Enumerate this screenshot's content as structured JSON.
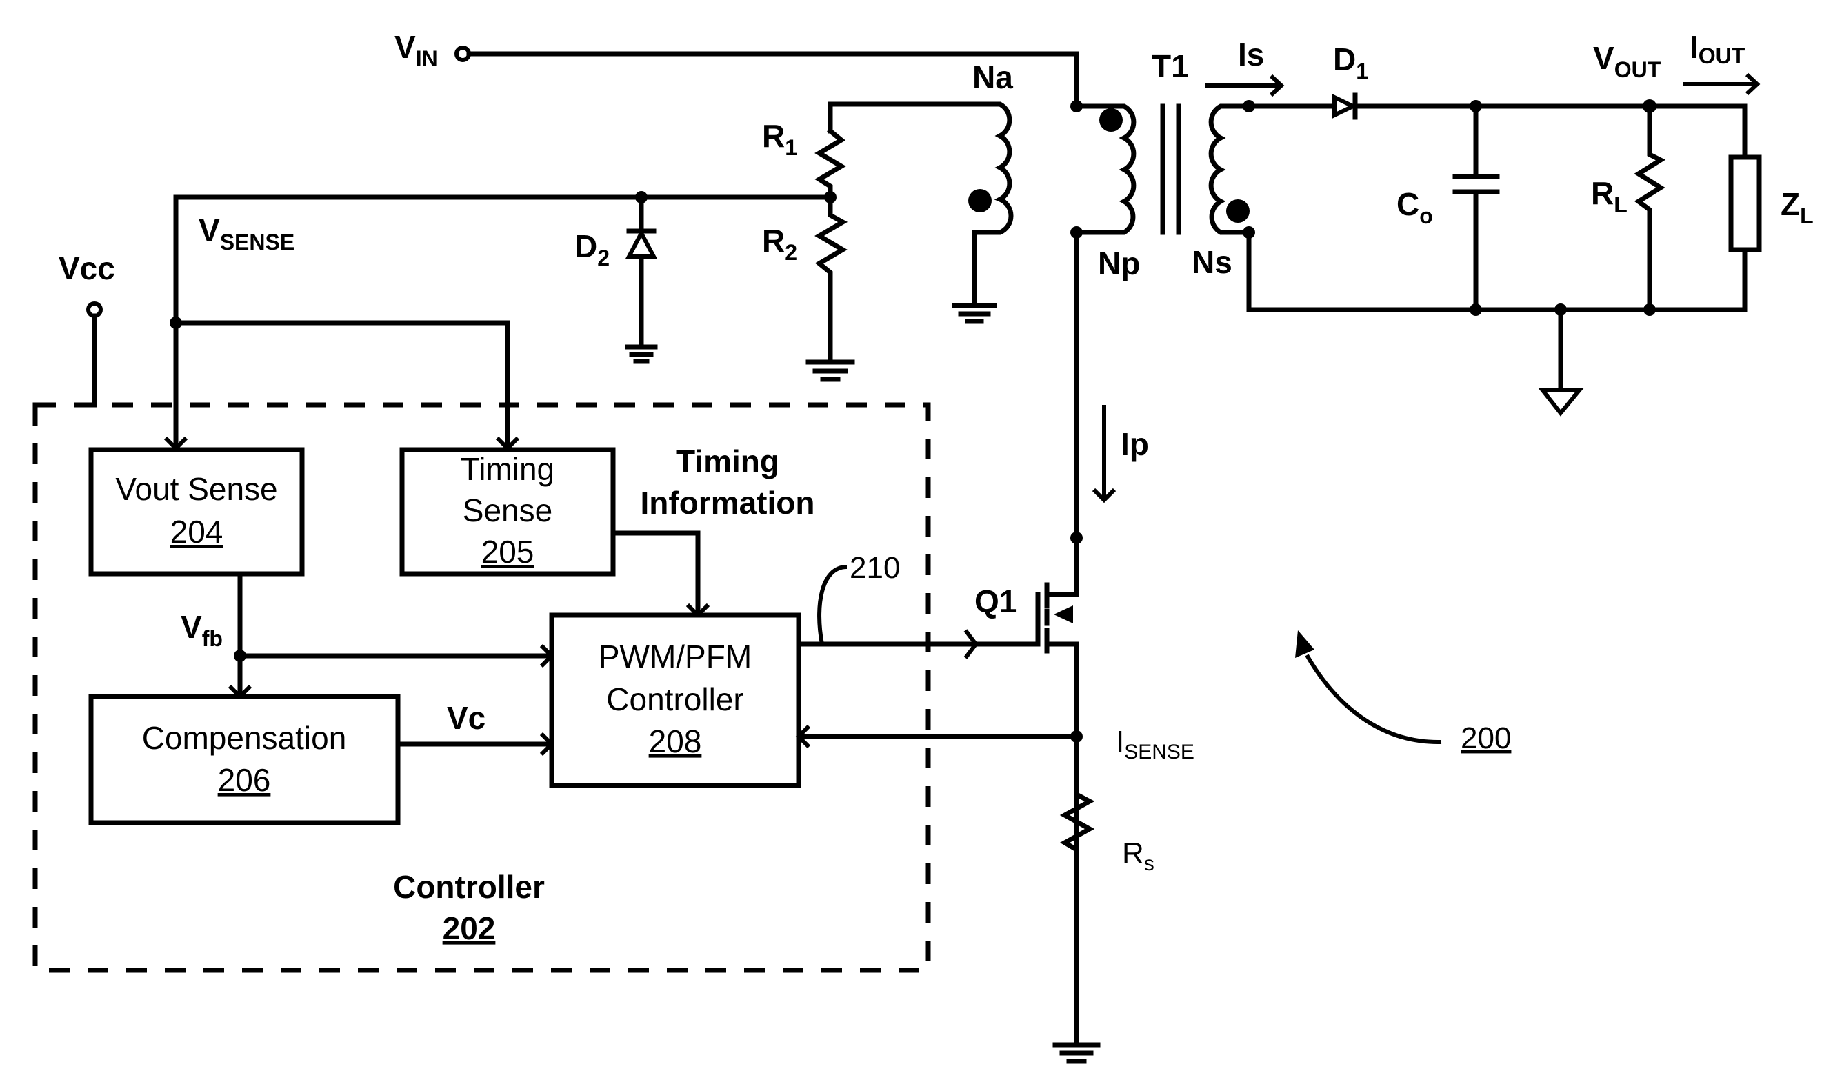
{
  "figure": {
    "reference_number": "200",
    "colors": {
      "ink": "#000000",
      "background": "#ffffff"
    }
  },
  "terminals": {
    "vin": {
      "main": "V",
      "sub": "IN"
    },
    "vcc": {
      "main": "Vcc"
    },
    "vout": {
      "main": "V",
      "sub": "OUT"
    },
    "iout": {
      "main": "I",
      "sub": "OUT"
    }
  },
  "signals": {
    "vsense": {
      "main": "V",
      "sub": "SENSE"
    },
    "vfb": {
      "main": "V",
      "sub": "fb"
    },
    "vc": "Vc",
    "isense": {
      "main": "I",
      "sub": "SENSE"
    },
    "is": "Is",
    "ip": "Ip",
    "timing_info_line1": "Timing",
    "timing_info_line2": "Information",
    "gate_drive_ref": "210"
  },
  "components": {
    "transformer": "T1",
    "winding_aux": "Na",
    "winding_primary": "Np",
    "winding_secondary": "Ns",
    "d1": {
      "main": "D",
      "sub": "1"
    },
    "d2": {
      "main": "D",
      "sub": "2"
    },
    "r1": {
      "main": "R",
      "sub": "1"
    },
    "r2": {
      "main": "R",
      "sub": "2"
    },
    "co": {
      "main": "C",
      "sub": "o"
    },
    "rl": {
      "main": "R",
      "sub": "L"
    },
    "zl": {
      "main": "Z",
      "sub": "L"
    },
    "rs": {
      "main": "R",
      "sub": "s"
    },
    "q1": "Q1"
  },
  "controller": {
    "title": "Controller",
    "ref": "202",
    "blocks": [
      {
        "id": "vout-sense",
        "line1": "Vout Sense",
        "line2": "",
        "ref": "204"
      },
      {
        "id": "timing-sense",
        "line1": "Timing",
        "line2": "Sense",
        "ref": "205"
      },
      {
        "id": "compensation",
        "line1": "Compensation",
        "line2": "",
        "ref": "206"
      },
      {
        "id": "pwm-pfm",
        "line1": "PWM/PFM",
        "line2": "Controller",
        "ref": "208"
      }
    ]
  }
}
